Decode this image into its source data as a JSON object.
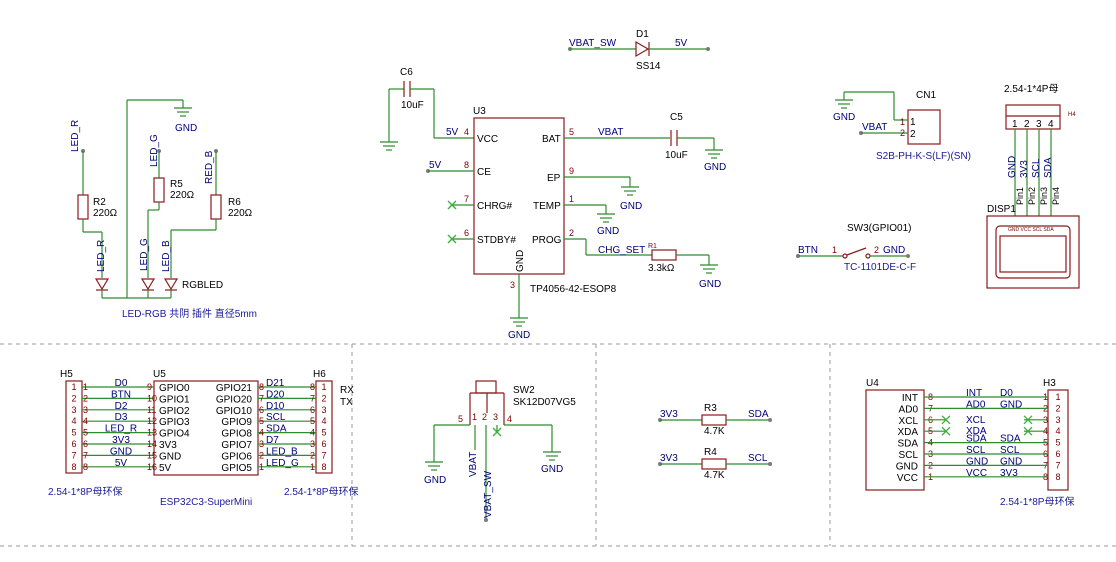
{
  "power": {
    "d1": {
      "ref": "D1",
      "value": "SS14",
      "in_net": "VBAT_SW",
      "out_net": "5V"
    },
    "c6": {
      "ref": "C6",
      "value": "10uF"
    },
    "c5": {
      "ref": "C5",
      "value": "10uF"
    },
    "r1": {
      "ref": "R1",
      "value": "3.3kΩ"
    },
    "u3": {
      "ref": "U3",
      "part": "TP4056-42-ESOP8",
      "pins": [
        {
          "num": "4",
          "name": "VCC"
        },
        {
          "num": "8",
          "name": "CE"
        },
        {
          "num": "7",
          "name": "CHRG#"
        },
        {
          "num": "6",
          "name": "STDBY#"
        },
        {
          "num": "5",
          "name": "BAT"
        },
        {
          "num": "9",
          "name": "EP"
        },
        {
          "num": "1",
          "name": "TEMP"
        },
        {
          "num": "2",
          "name": "PROG"
        },
        {
          "num": "3",
          "name": "GND"
        }
      ]
    },
    "nets": {
      "vcc": "5V",
      "ce": "5V",
      "bat": "VBAT",
      "chg": "CHG_SET",
      "gnd": "GND"
    }
  },
  "leds": {
    "r2": {
      "ref": "R2",
      "value": "220Ω",
      "net_top": "LED_R",
      "net_bot": "LED_R"
    },
    "r5": {
      "ref": "R5",
      "value": "220Ω",
      "net_top": "LED_G",
      "net_bot": "LED_G"
    },
    "r6": {
      "ref": "R6",
      "value": "220Ω",
      "net_top": "RED_B",
      "net_bot": "LED_B"
    },
    "gnd": "GND",
    "ref": "RGBLED",
    "desc": "LED-RGB 共阴 插件 直径5mm"
  },
  "cn1": {
    "ref": "CN1",
    "part": "S2B-PH-K-S(LF)(SN)",
    "net1": "GND",
    "net2": "VBAT",
    "pin1": "1",
    "pin2": "2"
  },
  "disp": {
    "title": "2.54-1*4P母",
    "ref": "H4",
    "disp_ref": "DISP1",
    "pins": [
      "1",
      "2",
      "3",
      "4"
    ],
    "nets": [
      "GND",
      "3V3",
      "SCL",
      "SDA"
    ],
    "pinnames": [
      "Pin1",
      "Pin2",
      "Pin3",
      "Pin4"
    ],
    "silk": "GND VCC SCL SDA"
  },
  "sw3": {
    "ref": "SW3(GPIO01)",
    "part": "TC-1101DE-C-F",
    "net1": "BTN",
    "net2": "GND",
    "pin1": "1",
    "pin2": "2"
  },
  "sw2": {
    "ref": "SW2",
    "part": "SK12D07VG5",
    "net1": "VBAT",
    "net2": "VBAT_SW",
    "net_gnd": "GND",
    "pins": [
      "5",
      "1",
      "2",
      "3",
      "4"
    ]
  },
  "i2c": {
    "r3": {
      "ref": "R3",
      "value": "4.7K",
      "net_left": "3V3",
      "net_right": "SDA"
    },
    "r4": {
      "ref": "R4",
      "value": "4.7K",
      "net_left": "3V3",
      "net_right": "SCL"
    }
  },
  "h5": {
    "ref": "H5",
    "title": "2.54-1*8P母环保",
    "pins": [
      "1",
      "2",
      "3",
      "4",
      "5",
      "6",
      "7",
      "8"
    ]
  },
  "h6": {
    "ref": "H6",
    "title": "2.54-1*8P母环保",
    "pins": [
      "1",
      "2",
      "3",
      "4",
      "5",
      "6",
      "7",
      "8"
    ]
  },
  "u5": {
    "ref": "U5",
    "title": "ESP32C3-SuperMini",
    "left": [
      {
        "num": "9",
        "name": "GPIO0",
        "net": "D0"
      },
      {
        "num": "10",
        "name": "GPIO1",
        "net": "BTN"
      },
      {
        "num": "11",
        "name": "GPIO2",
        "net": "D2"
      },
      {
        "num": "12",
        "name": "GPIO3",
        "net": "D3"
      },
      {
        "num": "13",
        "name": "GPIO4",
        "net": "LED_R"
      },
      {
        "num": "14",
        "name": "3V3",
        "net": "3V3"
      },
      {
        "num": "15",
        "name": "GND",
        "net": "GND"
      },
      {
        "num": "16",
        "name": "5V",
        "net": "5V"
      }
    ],
    "right": [
      {
        "num": "8",
        "name": "GPIO21",
        "net": "D21"
      },
      {
        "num": "7",
        "name": "GPIO20",
        "net": "D20"
      },
      {
        "num": "6",
        "name": "GPIO10",
        "net": "D10"
      },
      {
        "num": "5",
        "name": "GPIO9",
        "net": "SCL"
      },
      {
        "num": "4",
        "name": "GPIO8",
        "net": "SDA"
      },
      {
        "num": "3",
        "name": "GPIO7",
        "net": "D7"
      },
      {
        "num": "2",
        "name": "GPIO6",
        "net": "LED_B"
      },
      {
        "num": "1",
        "name": "GPIO5",
        "net": "LED_G"
      }
    ],
    "rx": "RX",
    "tx": "TX"
  },
  "u4": {
    "ref": "U4",
    "pins": [
      {
        "name": "INT",
        "num": "8",
        "net": "INT"
      },
      {
        "name": "AD0",
        "num": "7",
        "net": "AD0"
      },
      {
        "name": "XCL",
        "num": "6",
        "net": "XCL"
      },
      {
        "name": "XDA",
        "num": "5",
        "net": "XDA"
      },
      {
        "name": "SDA",
        "num": "4",
        "net": "SDA"
      },
      {
        "name": "SCL",
        "num": "3",
        "net": "SCL"
      },
      {
        "name": "GND",
        "num": "2",
        "net": "GND"
      },
      {
        "name": "VCC",
        "num": "1",
        "net": "VCC"
      }
    ]
  },
  "h3": {
    "ref": "H3",
    "title": "2.54-1*8P母环保",
    "pins": [
      "1",
      "2",
      "3",
      "4",
      "5",
      "6",
      "7",
      "8"
    ],
    "nets": [
      "D0",
      "GND",
      "",
      "",
      "SDA",
      "SCL",
      "GND",
      "3V3"
    ]
  }
}
